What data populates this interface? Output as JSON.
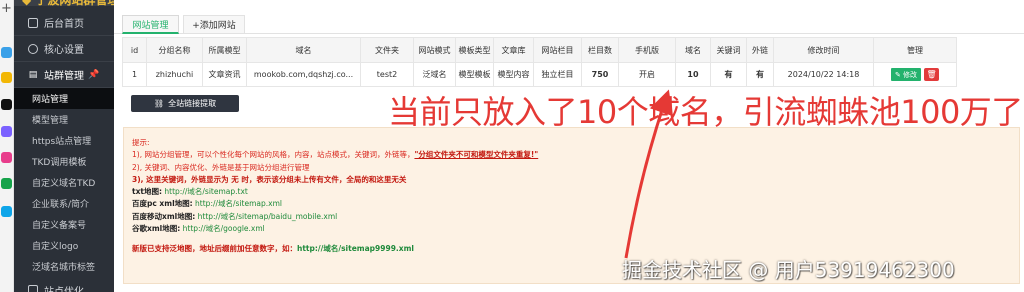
{
  "browser": {
    "new_tab_glyph": "+"
  },
  "sidebar": {
    "brand": "◆ 宁波网站群管理系统",
    "sections": [
      {
        "label": "后台首页",
        "icon": "monitor-icon"
      },
      {
        "label": "核心设置",
        "icon": "gear-icon"
      },
      {
        "label": "站群管理",
        "icon": "stack-icon",
        "pin": "📌"
      }
    ],
    "items": [
      "网站管理",
      "模型管理",
      "https站点管理",
      "TKD调用模板",
      "自定义域名TKD",
      "企业联系/简介",
      "自定义备案号",
      "自定义logo",
      "泛域名城市标签"
    ],
    "bottom": "站点优化"
  },
  "tabs": [
    "网站管理",
    "+添加网站"
  ],
  "table": {
    "headers": [
      "id",
      "分组名称",
      "所属模型",
      "域名",
      "文件夹",
      "网站模式",
      "模板类型",
      "文章库",
      "网站栏目",
      "栏目数",
      "手机版",
      "域名",
      "关键词",
      "外链",
      "修改时间",
      "管理"
    ],
    "rows": [
      {
        "id": "1",
        "group": "zhizhuchi",
        "model": "文章资讯",
        "domain": "mookob.com,dqshzj.co...",
        "folder": "test2",
        "mode": "泛域名",
        "template": "模型模板",
        "library": "模型内容",
        "column": "独立栏目",
        "column_count": "750",
        "mobile": "开启",
        "domain_count": "10",
        "keywords": "有",
        "links": "有",
        "modified": "2024/10/22 14:18",
        "edit_label": "✎ 修改",
        "delete_label": "🗑"
      }
    ]
  },
  "extract_button": {
    "icon": "link-icon",
    "label": "全站链接提取"
  },
  "tips": {
    "title": "提示:",
    "line1_a": "1), 网站分组管理，可以个性化每个网站的风格，内容，站点模式，关键词，外链等，",
    "line1_b": "\"分组文件夹不可和模型文件夹重复!\"",
    "line2": "2), 关键词、内容优化、外链是基于网站分组进行管理",
    "line3": "3), 这里关键词，外链显示为 无 时，表示该分组未上传有文件，全局的和这里无关",
    "sitemaps": [
      {
        "label": "txt地图:",
        "url": "http://域名/sitemap.txt"
      },
      {
        "label": "百度pc xml地图:",
        "url": "http://域名/sitemap.xml"
      },
      {
        "label": "百度移动xml地图:",
        "url": "http://域名/sitemap/baidu_mobile.xml"
      },
      {
        "label": "谷歌xml地图:",
        "url": "http://域名/google.xml"
      }
    ],
    "footer_a": "新版已支持泛地图，地址后缀前加任意数字，如：",
    "footer_b": "http://域名/sitemap9999.xml"
  },
  "annotation": "当前只放入了10个域名，引流蜘蛛池100万了",
  "watermark": "掘金技术社区 @ 用户53919462300",
  "colors": {
    "sidebar_bg": "#2b3038",
    "accent_green": "#23b26d",
    "annotation_red": "#e53935",
    "tips_bg": "#fdf2e4"
  }
}
